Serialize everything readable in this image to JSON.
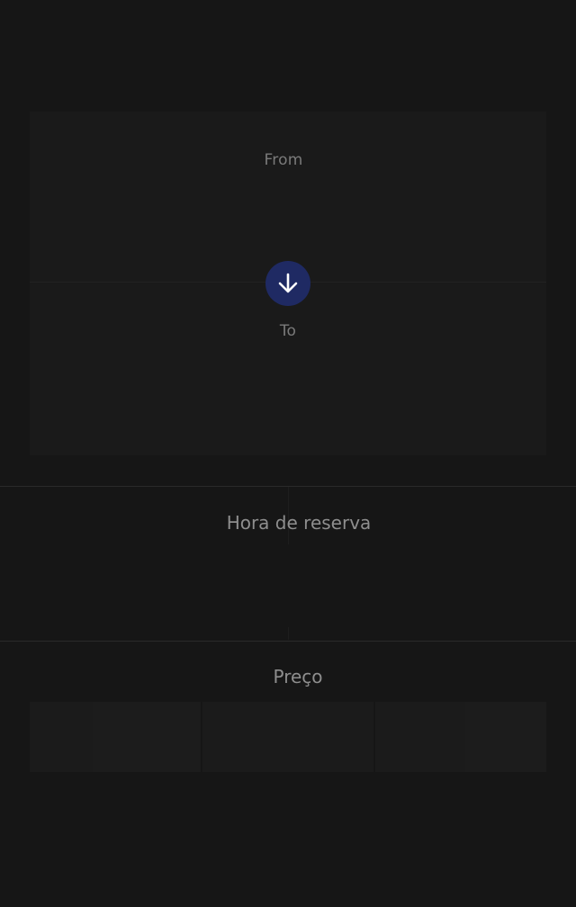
{
  "route": {
    "from_label": "From",
    "to_label": "To",
    "swap_icon": "arrow-down-icon",
    "swap_color": "#1f2a63"
  },
  "booking_time": {
    "title": "Hora de reserva"
  },
  "price": {
    "title": "Preço",
    "options": [
      "",
      "",
      ""
    ]
  },
  "colors": {
    "background": "#161616",
    "card": "#1a1a1a",
    "label": "#7a7a7a",
    "section_title": "#8e8e8e"
  }
}
